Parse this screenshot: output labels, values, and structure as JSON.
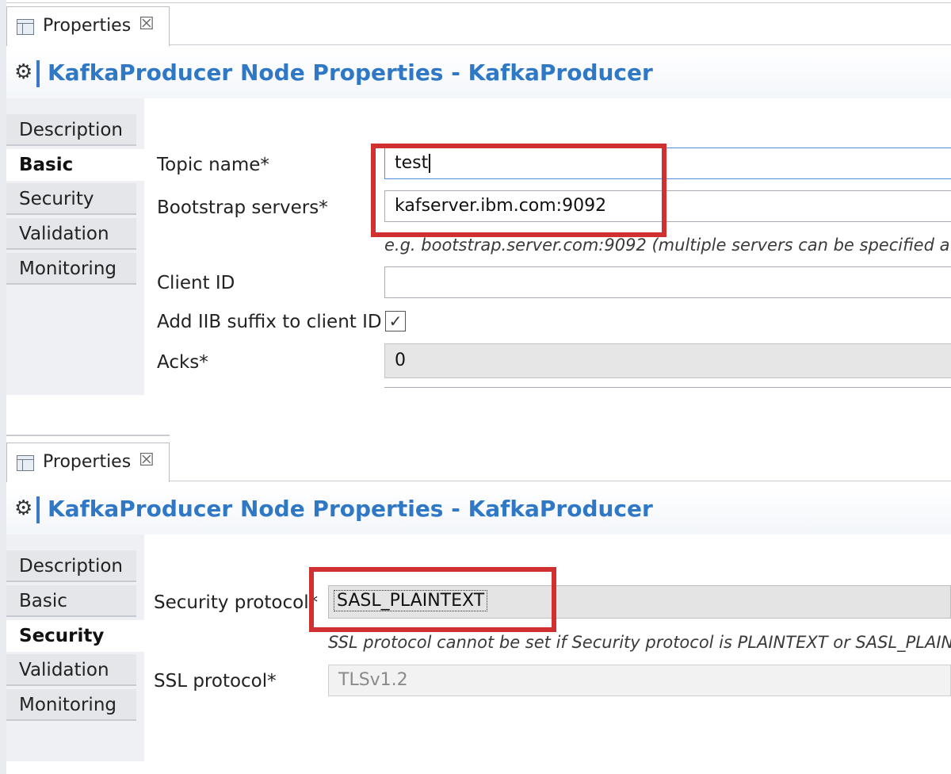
{
  "panel_top": {
    "tab_title": "Properties",
    "close_glyph": "☒",
    "header_title": "KafkaProducer Node Properties - KafkaProducer",
    "nav": [
      "Description",
      "Basic",
      "Security",
      "Validation",
      "Monitoring"
    ],
    "active_nav": "Basic",
    "fields": {
      "topic_label": "Topic name*",
      "topic_value": "test",
      "bootstrap_label": "Bootstrap servers*",
      "bootstrap_value": "kafserver.ibm.com:9092",
      "bootstrap_hint": "e.g. bootstrap.server.com:9092 (multiple servers can be specified and",
      "client_id_label": "Client ID",
      "client_id_value": "",
      "suffix_label": "Add IIB suffix to client ID",
      "suffix_checked": true,
      "acks_label": "Acks*",
      "acks_value": "0"
    }
  },
  "panel_bottom": {
    "tab_title": "Properties",
    "close_glyph": "☒",
    "header_title": "KafkaProducer Node Properties - KafkaProducer",
    "nav": [
      "Description",
      "Basic",
      "Security",
      "Validation",
      "Monitoring"
    ],
    "active_nav": "Security",
    "fields": {
      "security_protocol_label": "Security protocol*",
      "security_protocol_value": "SASL_PLAINTEXT",
      "ssl_hint": "SSL protocol cannot be set if Security protocol is PLAINTEXT or SASL_PLAINT",
      "ssl_protocol_label": "SSL protocol*",
      "ssl_protocol_value": "TLSv1.2"
    }
  },
  "colors": {
    "highlight_box": "#d0302f",
    "title_blue": "#2f78c5"
  },
  "icons": {
    "tab_icon": "properties-table-icon",
    "header_icon": "node-gear-icon"
  }
}
